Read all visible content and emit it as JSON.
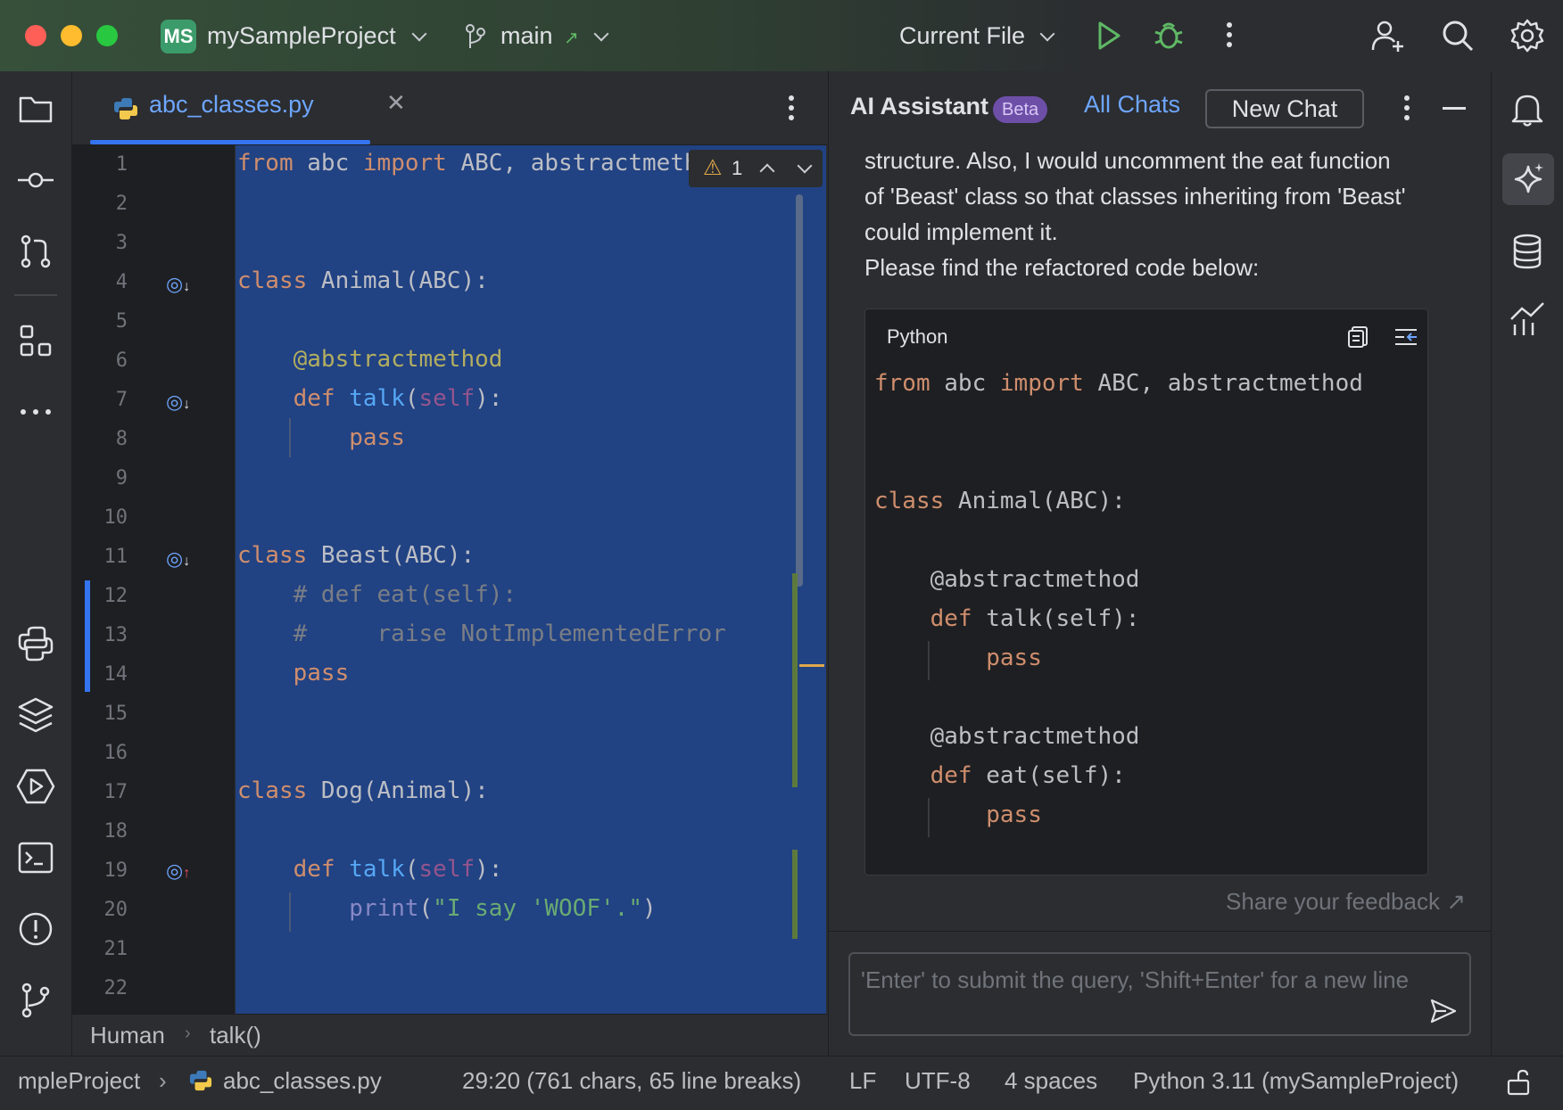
{
  "titlebar": {
    "project_badge": "MS",
    "project_name": "mySampleProject",
    "branch": "main",
    "run_config": "Current File"
  },
  "editor": {
    "tab_label": "abc_classes.py",
    "warning_count": "1",
    "line_numbers": [
      "1",
      "2",
      "3",
      "4",
      "5",
      "6",
      "7",
      "8",
      "9",
      "10",
      "11",
      "12",
      "13",
      "14",
      "15",
      "16",
      "17",
      "18",
      "19",
      "20",
      "21",
      "22"
    ],
    "breadcrumb": {
      "item1": "Human",
      "item2": "talk()"
    }
  },
  "ai_panel": {
    "title": "AI Assistant",
    "badge": "Beta",
    "all_chats": "All Chats",
    "new_chat": "New Chat",
    "message_lines": [
      "structure. Also, I would uncomment the eat function",
      "of 'Beast' class so that classes inheriting from 'Beast'",
      "could implement it.",
      "Please find the refactored code below:"
    ],
    "code_language": "Python",
    "feedback": "Share your feedback",
    "input_placeholder": "'Enter' to submit the query, 'Shift+Enter' for a new line"
  },
  "statusbar": {
    "project": "mpleProject",
    "file": "abc_classes.py",
    "position": "29:20 (761 chars, 65 line breaks)",
    "line_sep": "LF",
    "encoding": "UTF-8",
    "indent": "4 spaces",
    "interpreter": "Python 3.11 (mySampleProject)"
  },
  "colors": {
    "selection": "#214283",
    "accent": "#3574f0",
    "keyword": "#cf8e6d",
    "function": "#56a8f5",
    "string": "#6aab73",
    "comment": "#7a7e85"
  }
}
